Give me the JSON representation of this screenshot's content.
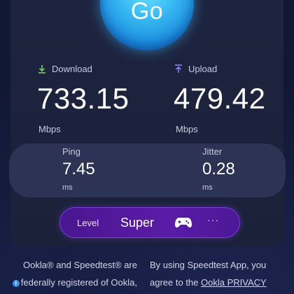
{
  "go_button": {
    "label": "Go"
  },
  "download": {
    "label": "Download",
    "value": "733.15",
    "unit": "Mbps",
    "icon": "download-arrow-icon",
    "icon_color": "#7fd35a"
  },
  "upload": {
    "label": "Upload",
    "value": "479.42",
    "unit": "Mbps",
    "icon": "upload-arrow-icon",
    "icon_color": "#8a7cff"
  },
  "ping": {
    "label": "Ping",
    "value": "7.45",
    "unit": "ms"
  },
  "jitter": {
    "label": "Jitter",
    "value": "0.28",
    "unit": "ms"
  },
  "level": {
    "label": "Level",
    "value": "Super",
    "icon": "gamepad-icon",
    "more": "···"
  },
  "footer": {
    "left_line1": "Ookla® and Speedtest® are",
    "left_line2": "federally registered of Ookla,",
    "right_line1": "By using Speedtest App, you",
    "right_line2_prefix": "agree to the",
    "right_link": "Ookla PRIVACY"
  },
  "colors": {
    "accent_blue": "#3bbcf5",
    "level_purple": "#5a1ca6",
    "panel": "#1e2440"
  }
}
